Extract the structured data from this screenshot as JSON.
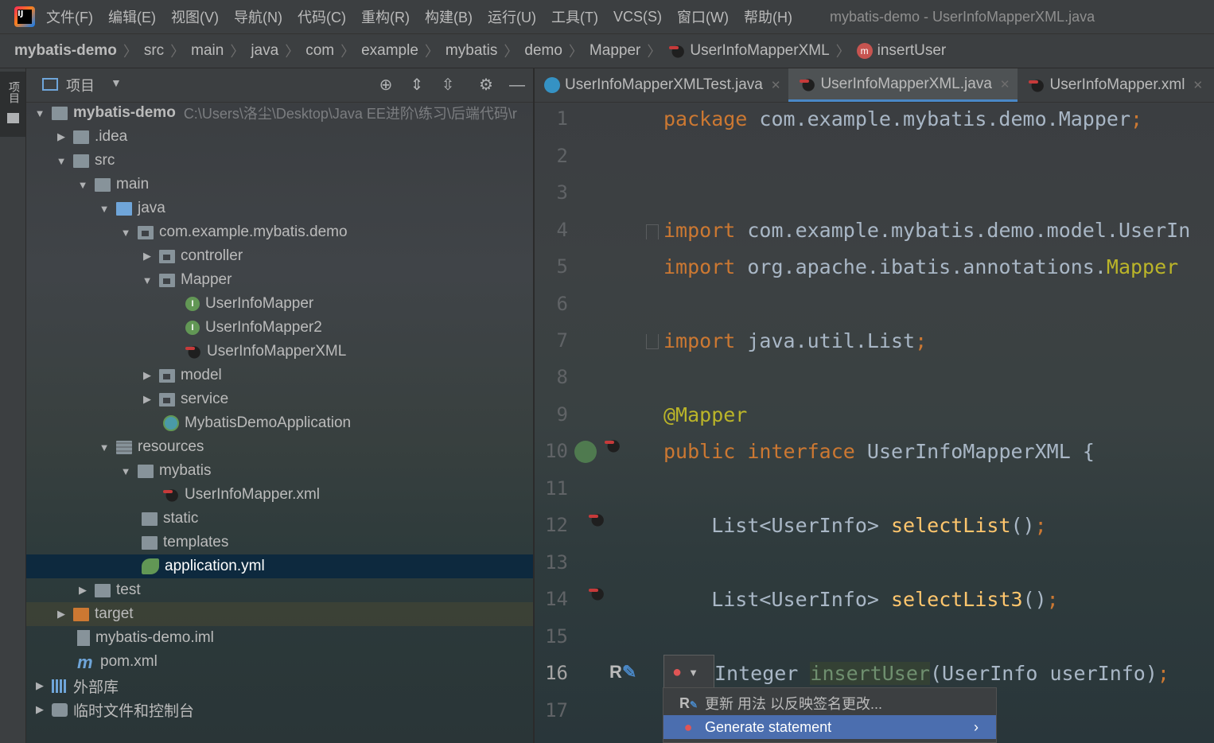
{
  "menubar": {
    "items": [
      "文件(F)",
      "编辑(E)",
      "视图(V)",
      "导航(N)",
      "代码(C)",
      "重构(R)",
      "构建(B)",
      "运行(U)",
      "工具(T)",
      "VCS(S)",
      "窗口(W)",
      "帮助(H)"
    ],
    "window_title": "mybatis-demo - UserInfoMapperXML.java"
  },
  "breadcrumb": [
    "mybatis-demo",
    "src",
    "main",
    "java",
    "com",
    "example",
    "mybatis",
    "demo",
    "Mapper",
    "UserInfoMapperXML",
    "insertUser"
  ],
  "stripe": {
    "project_tab": "项目"
  },
  "project": {
    "title": "项目",
    "root_path": "C:\\Users\\洛尘\\Desktop\\Java EE进阶\\练习\\后端代码\\r",
    "tree": [
      {
        "label": "mybatis-demo",
        "bold": true
      },
      {
        "label": ".idea"
      },
      {
        "label": "src"
      },
      {
        "label": "main"
      },
      {
        "label": "java"
      },
      {
        "label": "com.example.mybatis.demo"
      },
      {
        "label": "controller"
      },
      {
        "label": "Mapper"
      },
      {
        "label": "UserInfoMapper"
      },
      {
        "label": "UserInfoMapper2"
      },
      {
        "label": "UserInfoMapperXML"
      },
      {
        "label": "model"
      },
      {
        "label": "service"
      },
      {
        "label": "MybatisDemoApplication"
      },
      {
        "label": "resources"
      },
      {
        "label": "mybatis"
      },
      {
        "label": "UserInfoMapper.xml"
      },
      {
        "label": "static"
      },
      {
        "label": "templates"
      },
      {
        "label": "application.yml",
        "selected": true
      },
      {
        "label": "test"
      },
      {
        "label": "target"
      },
      {
        "label": "mybatis-demo.iml"
      },
      {
        "label": "pom.xml"
      },
      {
        "label": "外部库"
      },
      {
        "label": "临时文件和控制台"
      }
    ]
  },
  "tabs": [
    {
      "label": "UserInfoMapperXMLTest.java",
      "active": false
    },
    {
      "label": "UserInfoMapperXML.java",
      "active": true
    },
    {
      "label": "UserInfoMapper.xml",
      "active": false
    }
  ],
  "editor": {
    "line_numbers": [
      "1",
      "2",
      "3",
      "4",
      "5",
      "6",
      "7",
      "8",
      "9",
      "10",
      "11",
      "12",
      "13",
      "14",
      "15",
      "16",
      "17"
    ],
    "current_line": "16",
    "lines": {
      "l1": {
        "kw": "package",
        "rest": " com.example.mybatis.demo.Mapper",
        "semi": ";"
      },
      "l4": {
        "kw": "import",
        "rest": " com.example.mybatis.demo.model.UserIn"
      },
      "l5": {
        "kw": "import",
        "rest": " org.apache.ibatis.annotations.",
        "ann": "Mapper"
      },
      "l7": {
        "kw": "import",
        "rest": " java.util.List",
        "semi": ";"
      },
      "l9": {
        "ann": "@Mapper"
      },
      "l10": {
        "kw1": "public",
        "kw2": "interface",
        "rest": " UserInfoMapperXML {"
      },
      "l12": {
        "type": "    List<UserInfo> ",
        "fn": "selectList",
        "rest": "()",
        "semi": ";"
      },
      "l14": {
        "type": "    List<UserInfo> ",
        "fn": "selectList3",
        "rest": "()",
        "semi": ";"
      },
      "l16": {
        "type": "Integer ",
        "fn": "insertUser",
        "rest": "(UserInfo userInfo)",
        "semi": ";"
      }
    }
  },
  "popup": {
    "items": [
      {
        "label": "更新 用法 以反映签名更改...",
        "icon": "refactor-icon"
      },
      {
        "label": "Generate statement",
        "icon": "error-bulb-icon",
        "selected": true
      }
    ]
  },
  "colors": {
    "keyword": "#cc7832",
    "annotation": "#bbb529",
    "function": "#ffc66d",
    "selection": "#0d293e",
    "popup_selection": "#4b6eaf"
  }
}
